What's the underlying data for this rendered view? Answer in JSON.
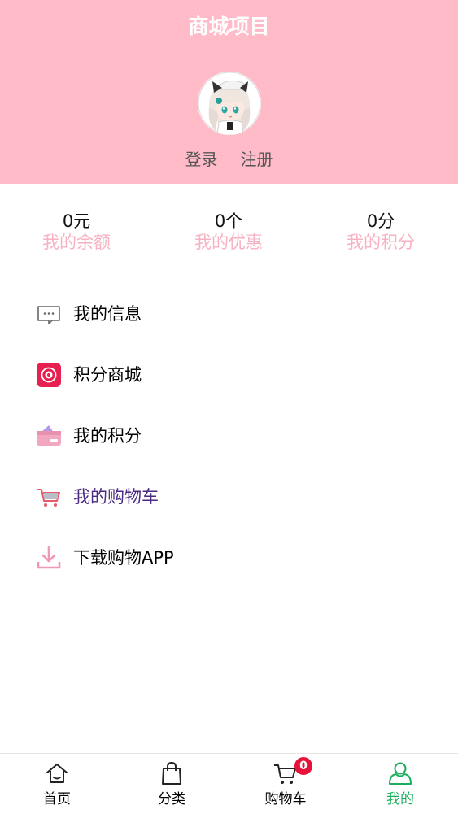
{
  "header": {
    "title": "商城项目",
    "login_label": "登录",
    "register_label": "注册"
  },
  "stats": [
    {
      "value": "0元",
      "label": "我的余额"
    },
    {
      "value": "0个",
      "label": "我的优惠"
    },
    {
      "value": "0分",
      "label": "我的积分"
    }
  ],
  "menu": [
    {
      "label": "我的信息",
      "icon": "message-icon"
    },
    {
      "label": "积分商城",
      "icon": "points-mall-icon"
    },
    {
      "label": "我的积分",
      "icon": "card-icon"
    },
    {
      "label": "我的购物车",
      "icon": "cart-icon",
      "color": "#4a2a82"
    },
    {
      "label": "下载购物APP",
      "icon": "download-icon"
    }
  ],
  "tabbar": [
    {
      "label": "首页",
      "icon": "home-icon"
    },
    {
      "label": "分类",
      "icon": "bag-icon"
    },
    {
      "label": "购物车",
      "icon": "cart-icon",
      "badge": "0"
    },
    {
      "label": "我的",
      "icon": "user-icon",
      "active": true
    }
  ],
  "colors": {
    "header_bg": "#ffbbc7",
    "stat_label": "#f7b2c2",
    "active_tab": "#1aad5b",
    "badge": "#e8113a",
    "cart_label": "#4a2a82"
  }
}
